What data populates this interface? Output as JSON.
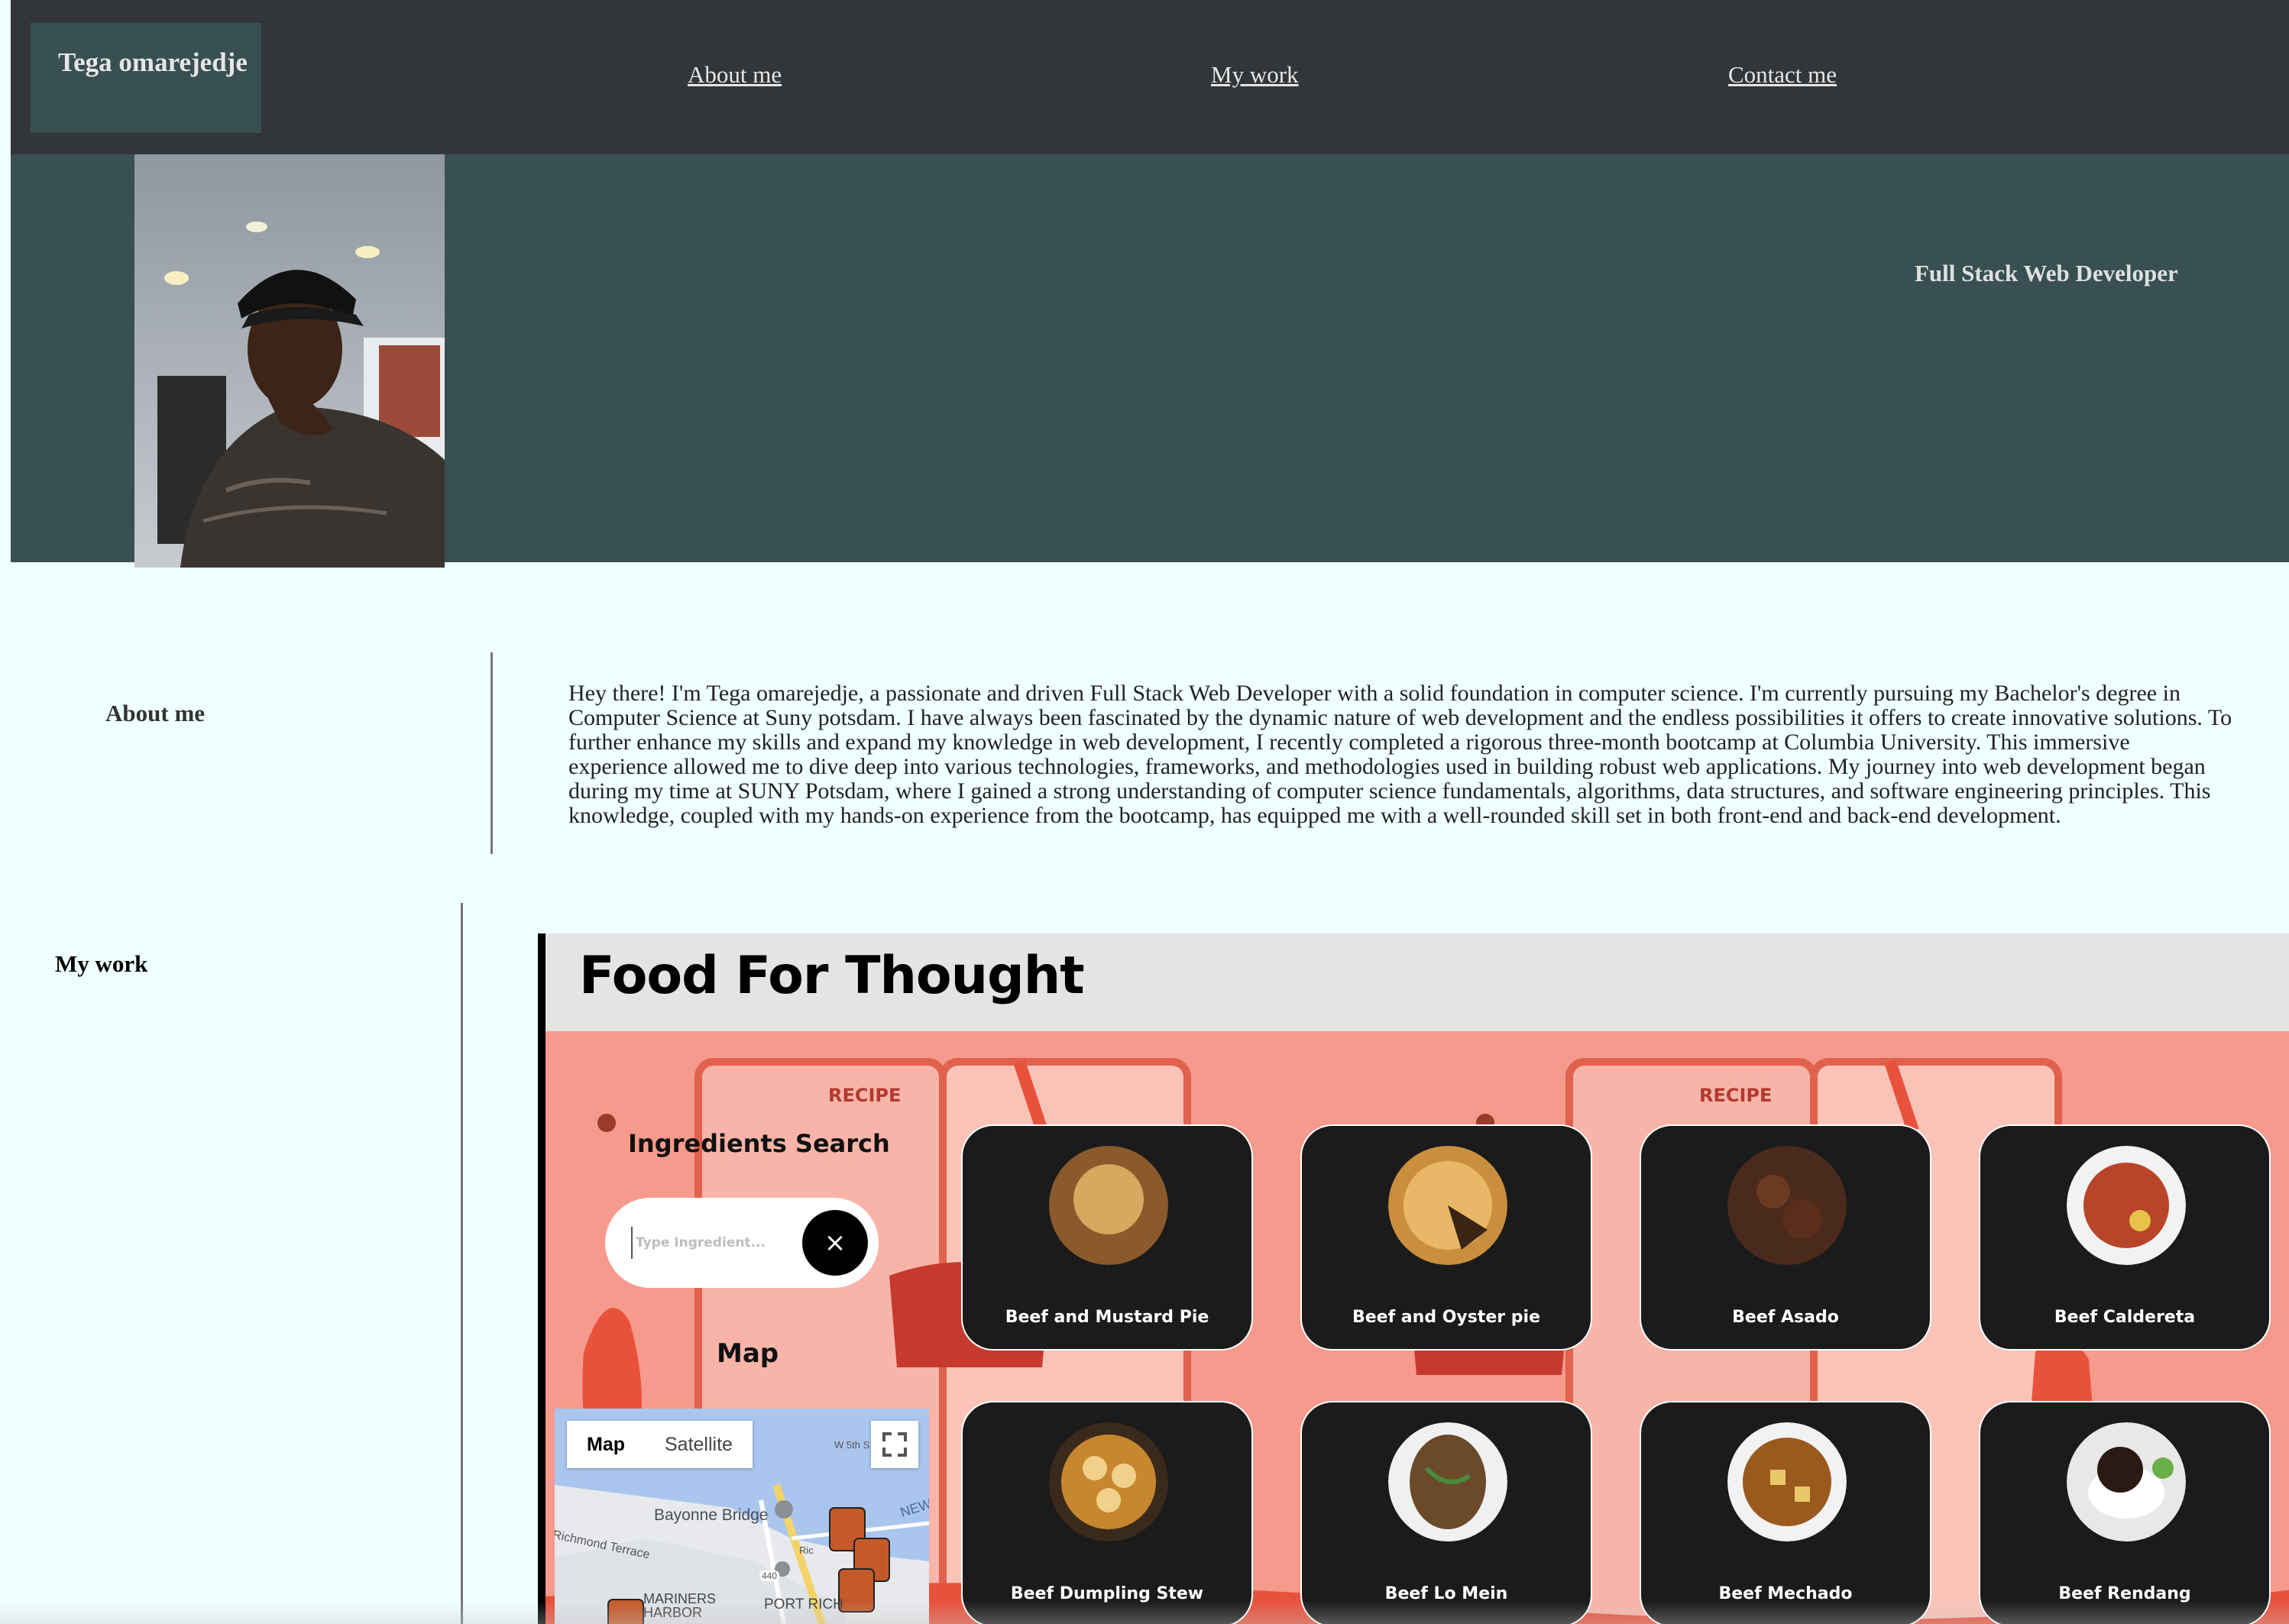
{
  "nav": {
    "brand": "Tega omarejedje",
    "links": [
      "About me",
      "My work",
      "Contact me"
    ]
  },
  "hero": {
    "tagline": "Full Stack Web Developer"
  },
  "about": {
    "label": "About me",
    "text": "Hey there! I'm Tega omarejedje, a passionate and driven Full Stack Web Developer with a solid foundation in computer science. I'm currently pursuing my Bachelor's degree in Computer Science at Suny potsdam. I have always been fascinated by the dynamic nature of web development and the endless possibilities it offers to create innovative solutions. To further enhance my skills and expand my knowledge in web development, I recently completed a rigorous three-month bootcamp at Columbia University. This immersive experience allowed me to dive deep into various technologies, frameworks, and methodologies used in building robust web applications. My journey into web development began during my time at SUNY Potsdam, where I gained a strong understanding of computer science fundamentals, algorithms, data structures, and software engineering principles. This knowledge, coupled with my hands-on experience from the bootcamp, has equipped me with a well-rounded skill set in both front-end and back-end development."
  },
  "work": {
    "label": "My work",
    "project": {
      "title": "Food For Thought",
      "bg_words": [
        "RECIPE",
        "RECIPE"
      ],
      "ingredients_title": "Ingredients Search",
      "search_placeholder": "Type Ingredient...",
      "clear_icon": "×",
      "map_title": "Map",
      "map": {
        "tabs": [
          "Map",
          "Satellite"
        ],
        "labels": [
          "Bayonne Bridge",
          "Richmond Terrace",
          "MARINERS HARBOR",
          "PORT RICH",
          "W 5th S",
          "NEW",
          "440",
          "Ric"
        ]
      },
      "recipes": [
        {
          "name": "Beef and Mustard Pie",
          "color": "#8a5a2c"
        },
        {
          "name": "Beef and Oyster pie",
          "color": "#c98f3e"
        },
        {
          "name": "Beef Asado",
          "color": "#4a2a1c"
        },
        {
          "name": "Beef Caldereta",
          "color": "#b8452a"
        },
        {
          "name": "Beef Dumpling Stew",
          "color": "#c7872e"
        },
        {
          "name": "Beef Lo Mein",
          "color": "#6b4a2a"
        },
        {
          "name": "Beef Mechado",
          "color": "#9a5a1e"
        },
        {
          "name": "Beef Rendang",
          "color": "#2a1a14"
        }
      ]
    }
  }
}
